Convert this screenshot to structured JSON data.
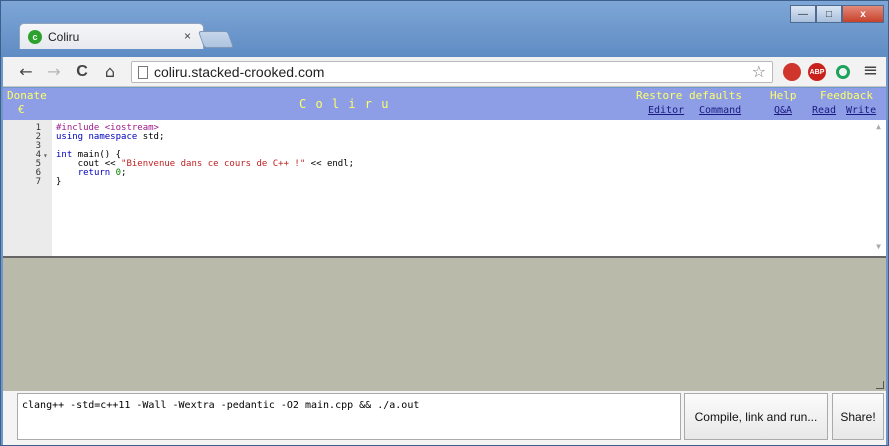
{
  "browser": {
    "tab_title": "Coliru",
    "tab_close": "×",
    "favicon_letter": "c",
    "url": "coliru.stacked-crooked.com",
    "nav": {
      "back": "←",
      "forward": "→",
      "reload": "C",
      "home": "⌂"
    },
    "extensions": [
      {
        "name": "opera-ext-icon",
        "label": "",
        "color": "#d0352b"
      },
      {
        "name": "adblock-plus-icon",
        "label": "ABP",
        "color": "#c9221c"
      },
      {
        "name": "green-ext-icon",
        "label": "",
        "color": "#19a35b"
      }
    ],
    "window_buttons": {
      "minimize": "—",
      "maximize": "□",
      "close": "x"
    }
  },
  "header": {
    "donate_label": "Donate",
    "donate_symbol": "€",
    "title": "C o l i r u",
    "restore_defaults_label": "Restore defaults",
    "editor_link": "Editor",
    "command_link": "Command",
    "help_label": "Help",
    "qa_link": "Q&A",
    "feedback_label": "Feedback",
    "read_link": "Read",
    "write_link": "Write"
  },
  "editor": {
    "lines": [
      {
        "number": "1",
        "fold": "",
        "parts": [
          {
            "t": "#include <iostream>",
            "c": "pp"
          }
        ]
      },
      {
        "number": "2",
        "fold": "",
        "parts": [
          {
            "t": "using namespace",
            "c": "kw"
          },
          {
            "t": " std;",
            "c": ""
          }
        ]
      },
      {
        "number": "3",
        "fold": "",
        "parts": []
      },
      {
        "number": "4",
        "fold": "▾",
        "parts": [
          {
            "t": "int",
            "c": "kw"
          },
          {
            "t": " main() {",
            "c": ""
          }
        ]
      },
      {
        "number": "5",
        "fold": "",
        "parts": [
          {
            "t": "    cout << ",
            "c": ""
          },
          {
            "t": "\"Bienvenue dans ce cours de C++ !\"",
            "c": "str"
          },
          {
            "t": " << endl;",
            "c": ""
          }
        ]
      },
      {
        "number": "6",
        "fold": "",
        "parts": [
          {
            "t": "    ",
            "c": ""
          },
          {
            "t": "return",
            "c": "kw"
          },
          {
            "t": " ",
            "c": ""
          },
          {
            "t": "0",
            "c": "num"
          },
          {
            "t": ";",
            "c": ""
          }
        ]
      },
      {
        "number": "7",
        "fold": "",
        "parts": [
          {
            "t": "}",
            "c": ""
          }
        ]
      }
    ]
  },
  "command": {
    "value": "clang++ -std=c++11 -Wall -Wextra -pedantic -O2 main.cpp && ./a.out",
    "compile_button": "Compile, link and run...",
    "share_button": "Share!"
  },
  "colors": {
    "header_bg": "#8d9ee6",
    "header_text": "#ffff66",
    "output_bg": "#b9baa9"
  }
}
